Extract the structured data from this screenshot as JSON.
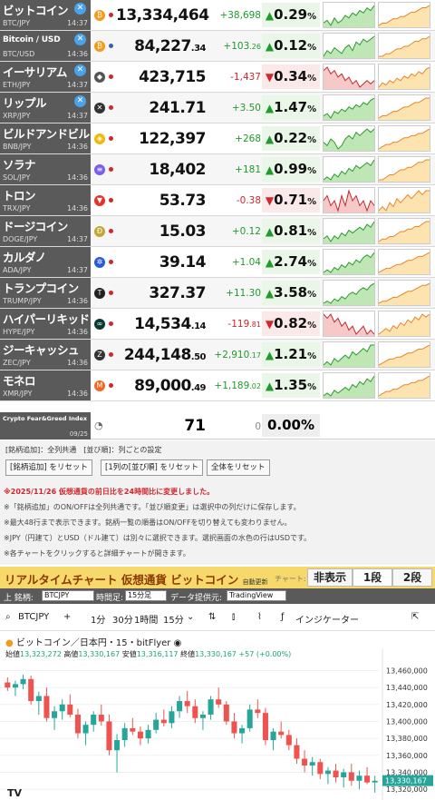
{
  "colors": {
    "up": "#209a2c",
    "down": "#d2262c",
    "candle_up": "#26a69a",
    "candle_down": "#ef5350",
    "accent_bar": "#f7d86a"
  },
  "rows": [
    {
      "name": "ビットコイン",
      "small": false,
      "pair": "BTC/JPY",
      "time": "14:37",
      "x": true,
      "icon": "bitcoin-icon",
      "ic": "₿",
      "icolor": "#f39a1a",
      "flag": "jp",
      "price": "13,334,464",
      "price_dec": "",
      "change": "+38,698",
      "change_dec": "",
      "dir": "up",
      "pct": "0.29",
      "arrow": "▲",
      "t1": [
        5,
        6,
        4,
        7,
        5,
        6,
        8,
        7,
        9,
        8,
        10,
        9,
        11,
        10,
        12
      ],
      "t2": [
        2,
        3,
        3,
        4,
        5,
        5,
        6,
        6,
        7,
        8,
        8,
        9,
        10,
        10,
        11
      ]
    },
    {
      "name": "Bitcoin / USD",
      "small": true,
      "pair": "BTC/USD",
      "time": "14:36",
      "x": true,
      "icon": "bitcoin-icon",
      "ic": "₿",
      "icolor": "#f39a1a",
      "flag": "us",
      "price": "84,227",
      "price_dec": ".34",
      "change": "+103",
      "change_dec": ".26",
      "dir": "up",
      "pct": "0.12",
      "arrow": "▲",
      "t1": [
        4,
        6,
        5,
        7,
        6,
        5,
        7,
        8,
        6,
        9,
        8,
        10,
        9,
        10,
        11
      ],
      "t2": [
        3,
        3,
        4,
        4,
        5,
        6,
        6,
        7,
        7,
        8,
        9,
        9,
        10,
        10,
        11
      ]
    },
    {
      "name": "イーサリアム",
      "small": false,
      "pair": "ETH/JPY",
      "time": "14:37",
      "x": true,
      "icon": "ethereum-icon",
      "ic": "◆",
      "icolor": "#555",
      "flag": "jp",
      "price": "423,715",
      "price_dec": "",
      "change": "-1,437",
      "change_dec": "",
      "dir": "down",
      "pct": "0.34",
      "arrow": "▼",
      "t1": [
        9,
        10,
        8,
        9,
        7,
        8,
        6,
        7,
        5,
        6,
        4,
        5,
        6,
        5,
        6
      ],
      "t2": [
        2,
        4,
        3,
        5,
        4,
        6,
        5,
        7,
        6,
        8,
        7,
        9,
        8,
        10,
        11
      ]
    },
    {
      "name": "リップル",
      "small": false,
      "pair": "XRP/JPY",
      "time": "14:37",
      "x": true,
      "icon": "xrp-icon",
      "ic": "✕",
      "icolor": "#333",
      "flag": "jp",
      "price": "241.71",
      "price_dec": "",
      "change": "+3.50",
      "change_dec": "",
      "dir": "up",
      "pct": "1.47",
      "arrow": "▲",
      "t1": [
        4,
        5,
        3,
        6,
        5,
        7,
        6,
        8,
        7,
        9,
        8,
        10,
        9,
        11,
        12
      ],
      "t2": [
        3,
        4,
        4,
        5,
        6,
        6,
        7,
        8,
        8,
        9,
        10,
        10,
        11,
        12,
        12
      ]
    },
    {
      "name": "ビルドアンドビルド",
      "small": false,
      "pair": "BNB/JPY",
      "time": "14:36",
      "x": false,
      "icon": "bnb-icon",
      "ic": "◈",
      "icolor": "#f0b90b",
      "flag": "jp",
      "price": "122,397",
      "price_dec": "",
      "change": "+268",
      "change_dec": "",
      "dir": "up",
      "pct": "0.22",
      "arrow": "▲",
      "t1": [
        6,
        5,
        7,
        6,
        4,
        5,
        7,
        8,
        7,
        9,
        8,
        9,
        10,
        9,
        10
      ],
      "t2": [
        2,
        3,
        4,
        4,
        5,
        5,
        6,
        7,
        7,
        8,
        8,
        9,
        9,
        10,
        11
      ]
    },
    {
      "name": "ソラナ",
      "small": false,
      "pair": "SOL/JPY",
      "time": "14:36",
      "x": false,
      "icon": "solana-icon",
      "ic": "≡",
      "icolor": "#7b5cf0",
      "flag": "jp",
      "price": "18,402",
      "price_dec": "",
      "change": "+181",
      "change_dec": "",
      "dir": "up",
      "pct": "0.99",
      "arrow": "▲",
      "t1": [
        5,
        6,
        5,
        7,
        6,
        8,
        7,
        9,
        8,
        10,
        9,
        10,
        11,
        10,
        12
      ],
      "t2": [
        3,
        3,
        4,
        5,
        5,
        6,
        7,
        7,
        8,
        8,
        9,
        10,
        10,
        11,
        11
      ]
    },
    {
      "name": "トロン",
      "small": false,
      "pair": "TRX/JPY",
      "time": "14:36",
      "x": false,
      "icon": "tron-icon",
      "ic": "▼",
      "icolor": "#e5332a",
      "flag": "jp",
      "price": "53.73",
      "price_dec": "",
      "change": "-0.38",
      "change_dec": "",
      "dir": "down",
      "pct": "0.71",
      "arrow": "▼",
      "t1": [
        8,
        9,
        7,
        8,
        6,
        9,
        7,
        10,
        8,
        9,
        7,
        8,
        6,
        8,
        7
      ],
      "t2": [
        5,
        6,
        5,
        7,
        6,
        8,
        7,
        8,
        9,
        8,
        9,
        10,
        9,
        10,
        10
      ]
    },
    {
      "name": "ドージコイン",
      "small": false,
      "pair": "DOGE/JPY",
      "time": "14:37",
      "x": false,
      "icon": "dogecoin-icon",
      "ic": "Ð",
      "icolor": "#c2a633",
      "flag": "jp",
      "price": "15.03",
      "price_dec": "",
      "change": "+0.12",
      "change_dec": "",
      "dir": "up",
      "pct": "0.81",
      "arrow": "▲",
      "t1": [
        5,
        6,
        4,
        6,
        5,
        7,
        6,
        8,
        7,
        8,
        9,
        8,
        10,
        9,
        11
      ],
      "t2": [
        3,
        4,
        4,
        5,
        5,
        6,
        7,
        7,
        8,
        8,
        9,
        9,
        10,
        11,
        11
      ]
    },
    {
      "name": "カルダノ",
      "small": false,
      "pair": "ADA/JPY",
      "time": "14:37",
      "x": false,
      "icon": "cardano-icon",
      "ic": "✲",
      "icolor": "#2a5ada",
      "flag": "jp",
      "price": "39.14",
      "price_dec": "",
      "change": "+1.04",
      "change_dec": "",
      "dir": "up",
      "pct": "2.74",
      "arrow": "▲",
      "t1": [
        4,
        5,
        4,
        6,
        5,
        7,
        6,
        8,
        7,
        9,
        8,
        10,
        11,
        10,
        12
      ],
      "t2": [
        2,
        3,
        4,
        4,
        5,
        6,
        6,
        7,
        8,
        8,
        9,
        10,
        10,
        11,
        12
      ]
    },
    {
      "name": "トランプコイン",
      "small": false,
      "pair": "TRUMP/JPY",
      "time": "14:36",
      "x": false,
      "icon": "trump-icon",
      "ic": "T",
      "icolor": "#222",
      "flag": "jp",
      "price": "327.37",
      "price_dec": "",
      "change": "+11.30",
      "change_dec": "",
      "dir": "up",
      "pct": "3.58",
      "arrow": "▲",
      "t1": [
        3,
        4,
        3,
        5,
        4,
        6,
        5,
        7,
        8,
        7,
        9,
        10,
        9,
        11,
        12
      ],
      "t2": [
        2,
        3,
        3,
        4,
        5,
        5,
        6,
        7,
        8,
        8,
        9,
        10,
        11,
        11,
        12
      ]
    },
    {
      "name": "ハイパーリキッド",
      "small": false,
      "pair": "HYPE/JPY",
      "time": "14:36",
      "x": false,
      "icon": "hyperliquid-icon",
      "ic": "∞",
      "icolor": "#0a3a34",
      "flag": "jp",
      "price": "14,534",
      "price_dec": ".14",
      "change": "-119",
      "change_dec": ".81",
      "dir": "down",
      "pct": "0.82",
      "arrow": "▼",
      "t1": [
        10,
        9,
        10,
        8,
        9,
        7,
        8,
        6,
        7,
        5,
        6,
        7,
        5,
        6,
        5
      ],
      "t2": [
        3,
        4,
        5,
        4,
        6,
        5,
        7,
        6,
        8,
        7,
        9,
        8,
        10,
        9,
        10
      ]
    },
    {
      "name": "ジーキャッシュ",
      "small": false,
      "pair": "ZEC/JPY",
      "time": "14:36",
      "x": false,
      "icon": "zcash-icon",
      "ic": "Z",
      "icolor": "#333",
      "flag": "jp",
      "price": "244,148",
      "price_dec": ".50",
      "change": "+2,910",
      "change_dec": ".17",
      "dir": "up",
      "pct": "1.21",
      "arrow": "▲",
      "t1": [
        5,
        6,
        5,
        7,
        6,
        7,
        8,
        7,
        9,
        8,
        9,
        10,
        9,
        11,
        11
      ],
      "t2": [
        2,
        3,
        4,
        5,
        5,
        6,
        6,
        7,
        8,
        8,
        9,
        10,
        10,
        11,
        12
      ]
    },
    {
      "name": "モネロ",
      "small": false,
      "pair": "XMR/JPY",
      "time": "14:36",
      "x": false,
      "icon": "monero-icon",
      "ic": "M",
      "icolor": "#f26822",
      "flag": "jp",
      "price": "89,000",
      "price_dec": ".49",
      "change": "+1,189",
      "change_dec": ".02",
      "dir": "up",
      "pct": "1.35",
      "arrow": "▲",
      "t1": [
        4,
        5,
        4,
        6,
        5,
        6,
        7,
        6,
        8,
        7,
        9,
        8,
        10,
        9,
        11
      ],
      "t2": [
        3,
        4,
        5,
        5,
        6,
        6,
        7,
        8,
        8,
        9,
        9,
        10,
        10,
        11,
        12
      ]
    }
  ],
  "fear_greed": {
    "label": "Crypto Fear&Greed Index",
    "date": "09/25",
    "value": "71",
    "change": "0",
    "pct": "0.00%"
  },
  "legend": "[銘柄追加]：全列共通　[並び順]：列ごとの設定",
  "buttons": [
    "[銘柄追加] をリセット",
    "[1列の[並び順] をリセット",
    "全体をリセット"
  ],
  "notes": [
    "※2025/11/26 仮想通貨の前日比を24時間比に変更しました。",
    "※「銘柄追加」のON/OFFは全列共通です。「並び順変更」は選択中の列だけに保存します。",
    "※最大48行まで表示できます。銘柄一覧の順番はON/OFFを切り替えても変わりません。",
    "※JPY（円建て）とUSD（ドル建て）は別々に選択できます。選択画面の水色の行はUSDです。",
    "※各チャートをクリックすると詳細チャートが開きます。"
  ],
  "rt": {
    "title": "リアルタイムチャート 仮想通貨 ビットコイン",
    "auto": "自動更新",
    "chart_label": "チャート:",
    "opts": [
      "非表示",
      "1段",
      "2段"
    ]
  },
  "ctl": {
    "symbol_label": "上 銘柄:",
    "symbol": "BTCJPY",
    "interval_label": "時間足:",
    "interval": "15分足",
    "provider_label": "データ提供元:",
    "provider": "TradingView"
  },
  "tv": {
    "symbol": "BTCJPY",
    "intervals": [
      "1分",
      "30分",
      "1時間",
      "15分"
    ],
    "indicators": "インジケーター",
    "title": "ビットコイン／日本円・15・bitFlyer",
    "o": "13,323,272",
    "h": "13,330,167",
    "l": "13,316,117",
    "c": "13,330,167",
    "chg": "+57 (+0.00%)",
    "o_l": "始値",
    "h_l": "高値",
    "l_l": "安値",
    "c_l": "終値",
    "cur": "13,330,167"
  },
  "chart_data": {
    "type": "candlestick",
    "ylim": [
      13318000,
      13468000
    ],
    "yticks": [
      "13,460,000",
      "13,440,000",
      "13,420,000",
      "13,400,000",
      "13,380,000",
      "13,360,000",
      "13,340,000",
      "13,320,000"
    ],
    "candles": [
      [
        13446,
        13452,
        13436,
        13440
      ],
      [
        13440,
        13448,
        13430,
        13444
      ],
      [
        13444,
        13455,
        13438,
        13450
      ],
      [
        13450,
        13454,
        13420,
        13424
      ],
      [
        13424,
        13435,
        13408,
        13430
      ],
      [
        13430,
        13440,
        13400,
        13404
      ],
      [
        13404,
        13418,
        13390,
        13412
      ],
      [
        13412,
        13426,
        13402,
        13420
      ],
      [
        13420,
        13432,
        13405,
        13408
      ],
      [
        13408,
        13415,
        13380,
        13386
      ],
      [
        13386,
        13400,
        13372,
        13396
      ],
      [
        13396,
        13412,
        13388,
        13408
      ],
      [
        13408,
        13420,
        13395,
        13400
      ],
      [
        13400,
        13408,
        13360,
        13366
      ],
      [
        13366,
        13385,
        13340,
        13378
      ],
      [
        13378,
        13398,
        13370,
        13392
      ],
      [
        13392,
        13404,
        13384,
        13388
      ],
      [
        13388,
        13394,
        13372,
        13380
      ],
      [
        13380,
        13396,
        13374,
        13390
      ],
      [
        13390,
        13410,
        13386,
        13402
      ],
      [
        13402,
        13414,
        13394,
        13398
      ],
      [
        13398,
        13418,
        13392,
        13412
      ],
      [
        13412,
        13430,
        13404,
        13424
      ],
      [
        13424,
        13436,
        13410,
        13418
      ],
      [
        13418,
        13426,
        13398,
        13404
      ],
      [
        13404,
        13412,
        13390,
        13408
      ],
      [
        13408,
        13430,
        13402,
        13426
      ],
      [
        13426,
        13440,
        13416,
        13420
      ],
      [
        13420,
        13424,
        13396,
        13400
      ],
      [
        13400,
        13410,
        13380,
        13386
      ],
      [
        13386,
        13396,
        13374,
        13392
      ],
      [
        13392,
        13420,
        13388,
        13414
      ],
      [
        13414,
        13426,
        13404,
        13410
      ],
      [
        13410,
        13416,
        13372,
        13378
      ],
      [
        13378,
        13392,
        13366,
        13388
      ],
      [
        13388,
        13400,
        13380,
        13384
      ],
      [
        13384,
        13390,
        13366,
        13372
      ],
      [
        13372,
        13380,
        13350,
        13356
      ],
      [
        13356,
        13366,
        13340,
        13348
      ],
      [
        13348,
        13358,
        13336,
        13352
      ],
      [
        13352,
        13356,
        13332,
        13338
      ],
      [
        13338,
        13346,
        13326,
        13342
      ],
      [
        13342,
        13350,
        13328,
        13334
      ],
      [
        13334,
        13344,
        13322,
        13340
      ],
      [
        13340,
        13350,
        13324,
        13330
      ],
      [
        13330,
        13342,
        13320,
        13336
      ],
      [
        13336,
        13346,
        13326,
        13328
      ],
      [
        13328,
        13336,
        13316,
        13330
      ]
    ]
  }
}
